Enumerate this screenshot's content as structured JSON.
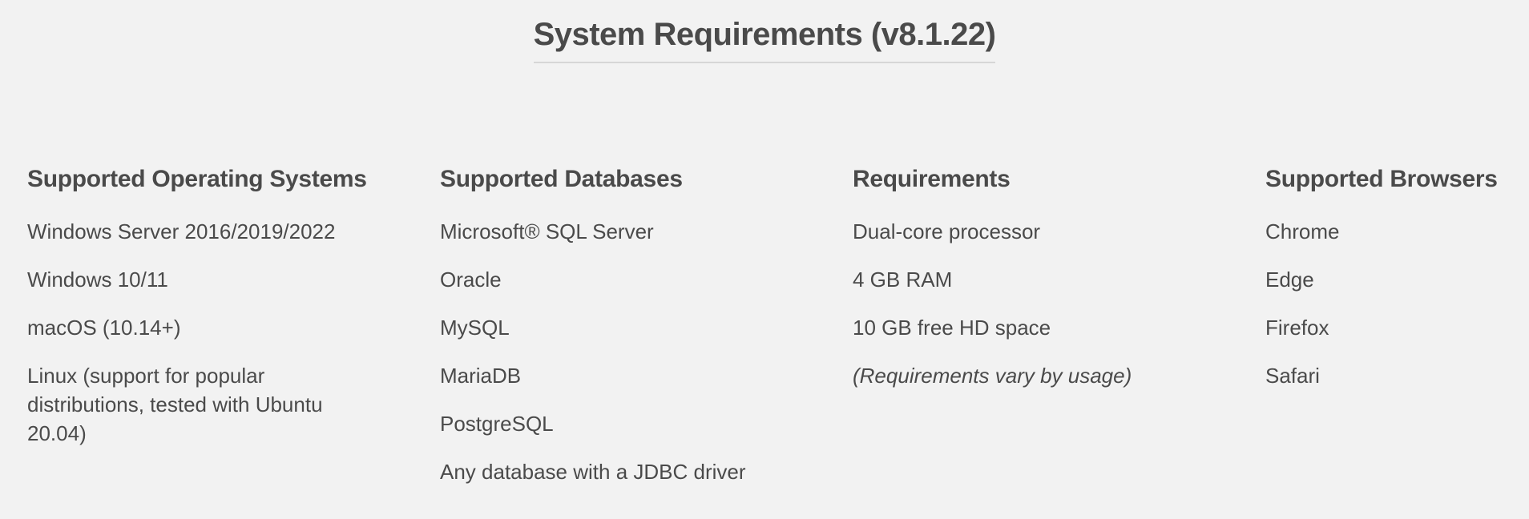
{
  "page": {
    "title": "System Requirements (v8.1.22)"
  },
  "columns": {
    "operating_systems": {
      "heading": "Supported Operating Systems",
      "items": [
        "Windows Server 2016/2019/2022",
        "Windows 10/11",
        "macOS (10.14+)",
        "Linux (support for popular distributions, tested with Ubuntu 20.04)"
      ]
    },
    "databases": {
      "heading": "Supported Databases",
      "items": [
        "Microsoft® SQL Server",
        "Oracle",
        "MySQL",
        "MariaDB",
        "PostgreSQL",
        "Any database with a JDBC driver"
      ]
    },
    "requirements": {
      "heading": "Requirements",
      "items": [
        "Dual-core processor",
        "4 GB RAM",
        "10 GB free HD space",
        "(Requirements vary by usage)"
      ]
    },
    "browsers": {
      "heading": "Supported Browsers",
      "items": [
        "Chrome",
        "Edge",
        "Firefox",
        "Safari"
      ]
    }
  },
  "colors": {
    "background": "#f2f2f2",
    "text": "#4a4a4a",
    "title_underline": "#d6d6d6"
  }
}
